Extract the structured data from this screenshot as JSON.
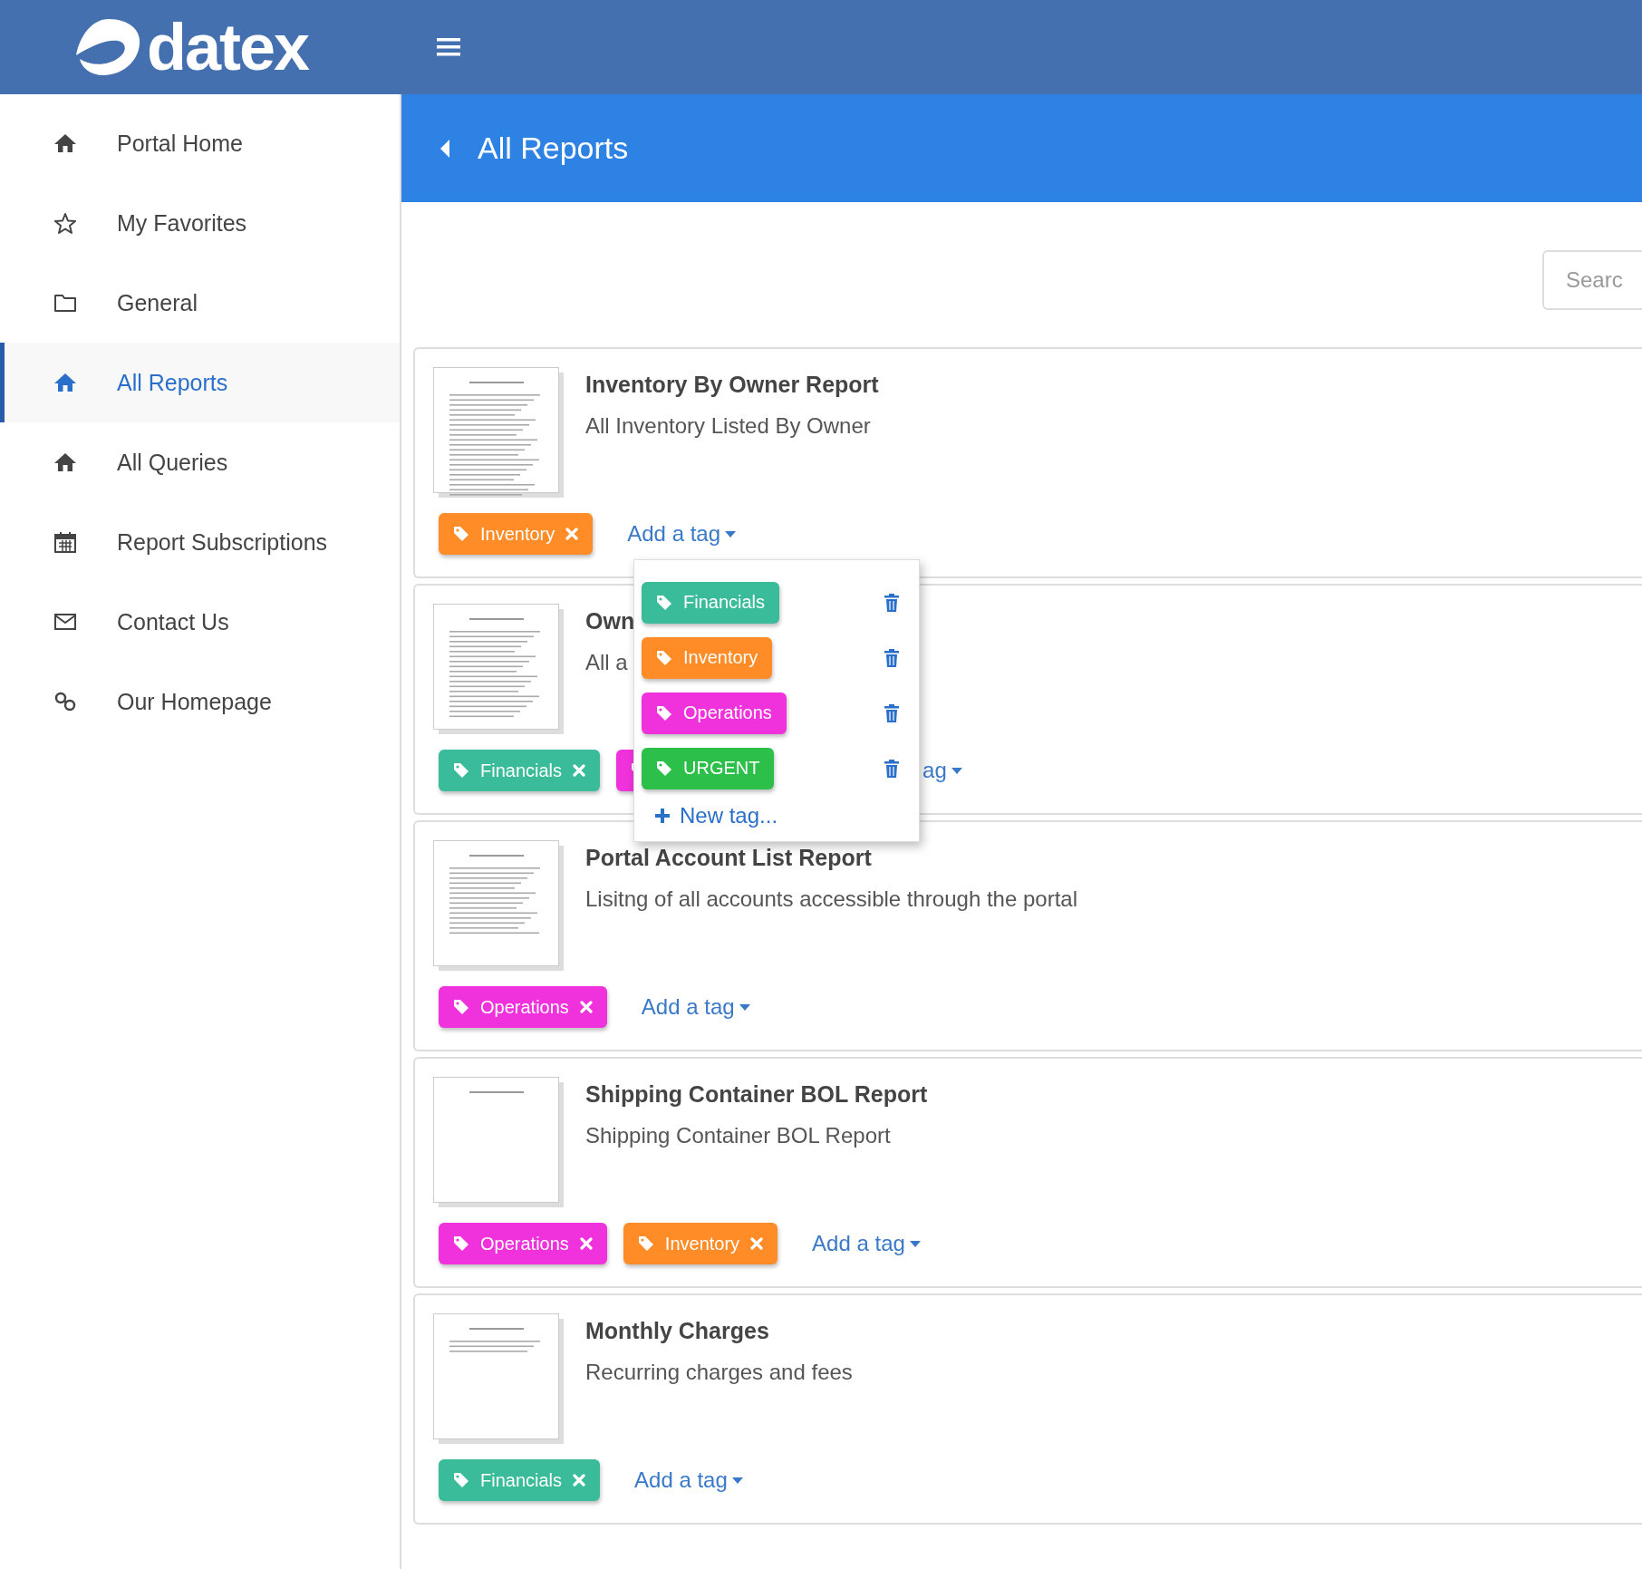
{
  "header": {
    "logo": "datex"
  },
  "sidebar": {
    "items": [
      {
        "label": "Portal Home",
        "kind": "home",
        "selected": false
      },
      {
        "label": "My Favorites",
        "kind": "star",
        "selected": false
      },
      {
        "label": "General",
        "kind": "folder",
        "selected": false
      },
      {
        "label": "All Reports",
        "kind": "home",
        "selected": true
      },
      {
        "label": "All Queries",
        "kind": "home",
        "selected": false
      },
      {
        "label": "Report Subscriptions",
        "kind": "calendar",
        "selected": false
      },
      {
        "label": "Contact Us",
        "kind": "envelope",
        "selected": false
      },
      {
        "label": "Our Homepage",
        "kind": "link",
        "selected": false
      }
    ]
  },
  "page_title": "All Reports",
  "search": {
    "placeholder": "Searc"
  },
  "reports": [
    {
      "title": "Inventory By Owner Report",
      "description": "All Inventory Listed By Owner",
      "tags": [
        {
          "label": "Inventory",
          "color": "#ff8c26"
        }
      ],
      "add_tag": "Add a tag"
    },
    {
      "title": "Own",
      "description": "All a",
      "tags": [
        {
          "label": "Financials",
          "color": "#3abb9a"
        },
        {
          "color": "#f032dc"
        }
      ],
      "add_tag": "ag"
    },
    {
      "title": "Portal Account List Report",
      "description": "Lisitng of all accounts accessible through the portal",
      "tags": [
        {
          "label": "Operations",
          "color": "#f032dc"
        }
      ],
      "add_tag": "Add a tag"
    },
    {
      "title": "Shipping Container BOL Report",
      "description": "Shipping Container BOL Report",
      "tags": [
        {
          "label": "Operations",
          "color": "#f032dc"
        },
        {
          "label": "Inventory",
          "color": "#ff8c26"
        }
      ],
      "add_tag": "Add a tag"
    },
    {
      "title": "Monthly Charges",
      "description": "Recurring charges and fees",
      "tags": [
        {
          "label": "Financials",
          "color": "#3abb9a"
        }
      ],
      "add_tag": "Add a tag"
    }
  ],
  "tag_menu": {
    "tags": [
      {
        "label": "Financials",
        "color": "#3abb9a"
      },
      {
        "label": "Inventory",
        "color": "#ff8c26"
      },
      {
        "label": "Operations",
        "color": "#f032dc"
      },
      {
        "label": "URGENT",
        "color": "#2cc04a"
      }
    ],
    "new_tag": "New tag..."
  }
}
